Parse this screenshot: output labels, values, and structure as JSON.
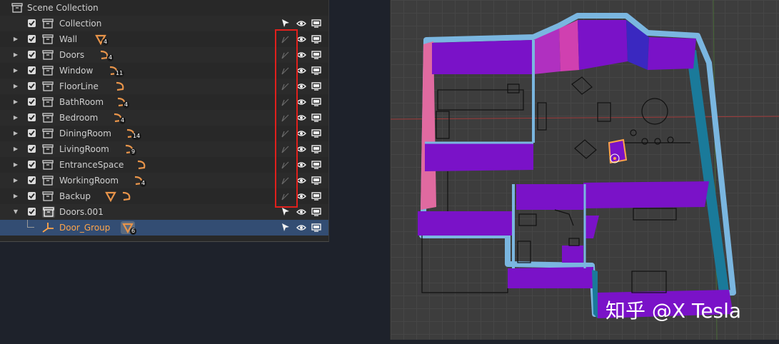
{
  "outliner": {
    "title": "Scene Collection",
    "rows": [
      {
        "label": "Collection",
        "count": ""
      },
      {
        "label": "Wall",
        "count": "4"
      },
      {
        "label": "Doors",
        "count": "4"
      },
      {
        "label": "Window",
        "count": "11"
      },
      {
        "label": "FloorLine",
        "count": ""
      },
      {
        "label": "BathRoom",
        "count": "4"
      },
      {
        "label": "Bedroom",
        "count": "4"
      },
      {
        "label": "DiningRoom",
        "count": "14"
      },
      {
        "label": "LivingRoom",
        "count": "9"
      },
      {
        "label": "EntranceSpace",
        "count": ""
      },
      {
        "label": "WorkingRoom",
        "count": "4"
      },
      {
        "label": "Backup",
        "count": ""
      },
      {
        "label": "Doors.001",
        "count": ""
      },
      {
        "label": "Door_Group",
        "count": "6"
      }
    ]
  },
  "viewport": {
    "watermark": "知乎 @X Tesla"
  },
  "colors": {
    "selection": "#334d73",
    "highlight_box": "#e0201c",
    "active_text": "#ffa54a",
    "wall_purple": "#7a12c8",
    "wall_edge": "#7ab6e0"
  }
}
